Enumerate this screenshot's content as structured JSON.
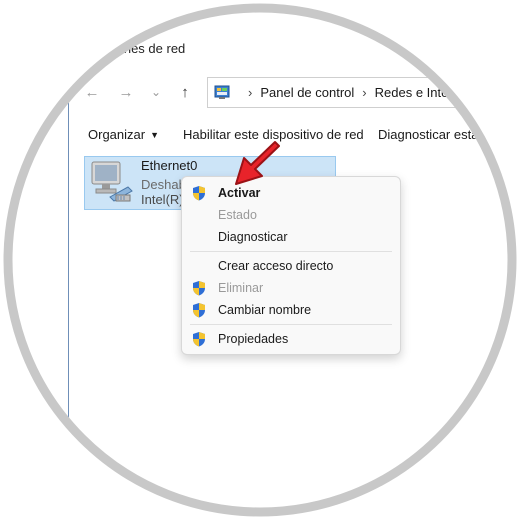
{
  "window": {
    "title": "exiones de red"
  },
  "nav": {
    "back": "←",
    "forward": "→",
    "recent": "⌄",
    "up": "↑"
  },
  "address": {
    "crumb1": "Panel de control",
    "crumb2": "Redes e Internet",
    "separator": "›"
  },
  "commandbar": {
    "organize": "Organizar",
    "enable": "Habilitar este dispositivo de red",
    "diagnose": "Diagnosticar esta co"
  },
  "adapter": {
    "name": "Ethernet0",
    "status": "Deshab",
    "device": "Intel(R)"
  },
  "context_menu": {
    "items": [
      {
        "label": "Activar",
        "icon": "shield-icon",
        "enabled": true,
        "bold": true
      },
      {
        "label": "Estado",
        "icon": "",
        "enabled": false
      },
      {
        "label": "Diagnosticar",
        "icon": "",
        "enabled": true
      },
      {
        "label": "Crear acceso directo",
        "icon": "",
        "enabled": true
      },
      {
        "label": "Eliminar",
        "icon": "shield-icon",
        "enabled": false
      },
      {
        "label": "Cambiar nombre",
        "icon": "shield-icon",
        "enabled": true
      },
      {
        "label": "Propiedades",
        "icon": "shield-icon",
        "enabled": true
      }
    ]
  },
  "colors": {
    "selection_bg": "#cce4f7",
    "selection_border": "#99c9ef",
    "arrow_red": "#e8232a",
    "frame_gray": "#c8c8c8"
  }
}
